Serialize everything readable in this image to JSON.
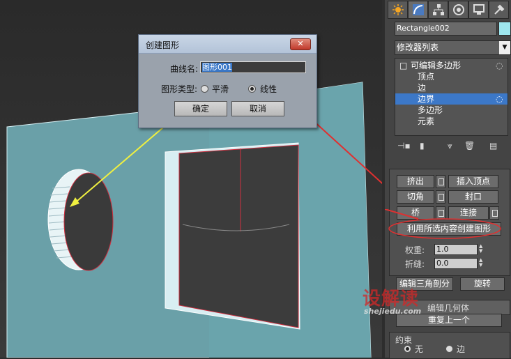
{
  "dialog": {
    "title": "创建图形",
    "close_symbol": "✕",
    "curve_name_label": "曲线名:",
    "curve_name_value": "图形001",
    "shape_type_label": "图形类型:",
    "option_smooth": "平滑",
    "option_linear": "线性",
    "selected_option": "线性",
    "ok_label": "确定",
    "cancel_label": "取消"
  },
  "panel": {
    "tabs": [
      {
        "icon": "create-icon"
      },
      {
        "icon": "modify-icon"
      },
      {
        "icon": "hierarchy-icon"
      },
      {
        "icon": "motion-icon"
      },
      {
        "icon": "display-icon"
      },
      {
        "icon": "utilities-icon"
      }
    ],
    "object_name": "Rectangle002",
    "object_color": "#9ee6ee",
    "modifier_list": "修改器列表",
    "stack": [
      {
        "label": "可编辑多边形",
        "expander": "□",
        "level": 0
      },
      {
        "label": "顶点",
        "level": 1
      },
      {
        "label": "边",
        "level": 1
      },
      {
        "label": "边界",
        "level": 1,
        "selected": true
      },
      {
        "label": "多边形",
        "level": 1
      },
      {
        "label": "元素",
        "level": 1
      }
    ],
    "edit_borders": {
      "extrude": "挤出",
      "insert_vertex": "插入顶点",
      "chamfer": "切角",
      "cap": "封口",
      "bridge": "桥",
      "connect": "连接",
      "create_shape": "利用所选内容创建图形",
      "weight_label": "权重:",
      "weight_value": "1.0",
      "crease_label": "折缝:",
      "crease_value": "0.0",
      "edit_tri": "编辑三角剖分",
      "turn": "旋转"
    },
    "edit_geometry_title": "编辑几何体",
    "repeat_last": "重复上一个",
    "constraints_label": "约束",
    "constraint_none": "无",
    "constraint_edge": "边"
  },
  "watermark": {
    "text": "设解读",
    "url": "shejiedu.com"
  },
  "colors": {
    "accent_selected": "#3c78c8",
    "plane": "#6aa0a8",
    "annotation_red": "#e03030",
    "annotation_yellow": "#f0f040"
  }
}
